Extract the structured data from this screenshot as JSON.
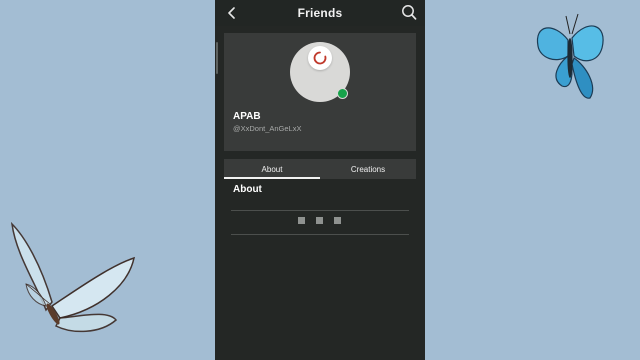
{
  "header": {
    "title": "Friends",
    "back_icon": "chevron-left-icon",
    "search_icon": "search-icon"
  },
  "profile": {
    "display_name": "APAB",
    "username": "@XxDont_AnGeLxX",
    "online_status_color": "#16a34a",
    "avatar_badge_icon": "loading-ring-icon"
  },
  "tabs": [
    {
      "label": "About",
      "active": true
    },
    {
      "label": "Creations",
      "active": false
    }
  ],
  "about": {
    "heading": "About",
    "loading_indicator": "three-square-dots"
  },
  "colors": {
    "background": "#a3bdd3",
    "phone_bg": "#242725",
    "card_bg": "#393b3a",
    "accent_red": "#c0392b"
  }
}
